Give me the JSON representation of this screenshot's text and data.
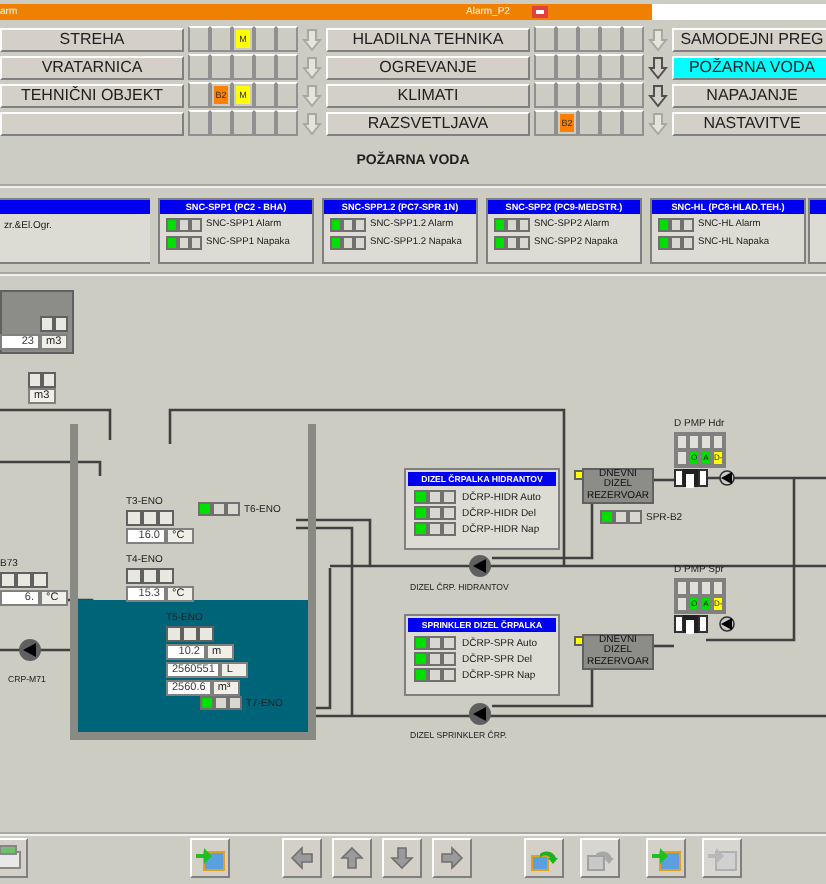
{
  "alarm_bar": {
    "left_text": "arm",
    "center_text": "Alarm_P2"
  },
  "nav_columns": [
    {
      "items": [
        {
          "label": "STREHA",
          "selected": false,
          "arrow_disabled": true,
          "cells": [
            {
              "kind": "blank"
            },
            {
              "kind": "blank"
            },
            {
              "kind": "badge",
              "text": "M",
              "color": "#ffff00"
            },
            {
              "kind": "blank"
            },
            {
              "kind": "blank"
            }
          ]
        },
        {
          "label": "VRATARNICA",
          "selected": false,
          "arrow_disabled": true,
          "cells": [
            {
              "kind": "blank"
            },
            {
              "kind": "blank"
            },
            {
              "kind": "blank"
            },
            {
              "kind": "blank"
            },
            {
              "kind": "blank"
            }
          ]
        },
        {
          "label": "TEHNIČNI OBJEKT",
          "selected": false,
          "arrow_disabled": true,
          "cells": [
            {
              "kind": "blank"
            },
            {
              "kind": "badge",
              "text": "B2",
              "color": "#ff8000"
            },
            {
              "kind": "badge",
              "text": "M",
              "color": "#ffff00"
            },
            {
              "kind": "blank"
            },
            {
              "kind": "blank"
            }
          ]
        },
        {
          "selected": false,
          "arrow_disabled": true,
          "cells": [
            {
              "kind": "blank"
            },
            {
              "kind": "blank"
            },
            {
              "kind": "blank"
            },
            {
              "kind": "blank"
            },
            {
              "kind": "blank"
            }
          ]
        }
      ]
    },
    {
      "items": [
        {
          "label": "HLADILNA TEHNIKA",
          "selected": false,
          "arrow_disabled": true,
          "cells": [
            {
              "kind": "blank"
            },
            {
              "kind": "blank"
            },
            {
              "kind": "blank"
            },
            {
              "kind": "blank"
            },
            {
              "kind": "blank"
            }
          ]
        },
        {
          "label": "OGREVANJE",
          "selected": false,
          "arrow_disabled": false,
          "cells": [
            {
              "kind": "blank"
            },
            {
              "kind": "blank"
            },
            {
              "kind": "blank"
            },
            {
              "kind": "blank"
            },
            {
              "kind": "blank"
            }
          ]
        },
        {
          "label": "KLIMATI",
          "selected": false,
          "arrow_disabled": false,
          "cells": [
            {
              "kind": "blank"
            },
            {
              "kind": "blank"
            },
            {
              "kind": "blank"
            },
            {
              "kind": "blank"
            },
            {
              "kind": "blank"
            }
          ]
        },
        {
          "label": "RAZSVETLJAVA",
          "selected": false,
          "arrow_disabled": true,
          "cells": [
            {
              "kind": "blank"
            },
            {
              "kind": "badge",
              "text": "B2",
              "color": "#ff8000"
            },
            {
              "kind": "blank"
            },
            {
              "kind": "blank"
            },
            {
              "kind": "blank"
            }
          ]
        }
      ]
    },
    {
      "items": [
        {
          "label": "SAMODEJNI PREG",
          "selected": false
        },
        {
          "label": "POŽARNA VODA",
          "selected": true
        },
        {
          "label": "NAPAJANJE",
          "selected": false
        },
        {
          "label": "NASTAVITVE",
          "selected": false
        }
      ]
    }
  ],
  "page_title": "POŽARNA VODA",
  "panels": [
    {
      "kind": "cut",
      "rows": [
        {
          "kind": "text",
          "label": "zr.&El.Ogr."
        }
      ]
    },
    {
      "title": "SNC-SPP1 (PC2 - BHA)",
      "rows": [
        {
          "kind": "lamp",
          "label": "SNC-SPP1 Alarm",
          "lamps": [
            true,
            false,
            false
          ]
        },
        {
          "kind": "lamp",
          "label": "SNC-SPP1 Napaka",
          "lamps": [
            true,
            false,
            false
          ]
        }
      ]
    },
    {
      "title": "SNC-SPP1.2 (PC7-SPR 1N)",
      "rows": [
        {
          "kind": "lamp",
          "label": "SNC-SPP1.2 Alarm",
          "lamps": [
            true,
            false,
            false
          ]
        },
        {
          "kind": "lamp",
          "label": "SNC-SPP1.2 Napaka",
          "lamps": [
            true,
            false,
            false
          ]
        }
      ]
    },
    {
      "title": "SNC-SPP2 (PC9-MEDSTR.)",
      "rows": [
        {
          "kind": "lamp",
          "label": "SNC-SPP2 Alarm",
          "lamps": [
            true,
            false,
            false
          ]
        },
        {
          "kind": "lamp",
          "label": "SNC-SPP2 Napaka",
          "lamps": [
            true,
            false,
            false
          ]
        }
      ]
    },
    {
      "title": "SNC-HL (PC8-HLAD.TEH.)",
      "rows": [
        {
          "kind": "lamp",
          "label": "SNC-HL Alarm",
          "lamps": [
            true,
            false,
            false
          ]
        },
        {
          "kind": "lamp",
          "label": "SNC-HL Napaka",
          "lamps": [
            true,
            false,
            false
          ]
        }
      ]
    },
    {
      "kind": "cut"
    }
  ],
  "storage_boxes": [
    {
      "value": "23",
      "unit": "m3"
    },
    {
      "unit": "m3"
    }
  ],
  "tank": {
    "level": 0.43
  },
  "sensors": [
    {
      "label": "B73",
      "values": [
        {
          "value": "6.",
          "unit": "°C"
        }
      ]
    },
    {
      "label": "T3-ENO",
      "values": [
        {
          "value": "16.0",
          "unit": "°C"
        }
      ]
    },
    {
      "label": "T4-ENO",
      "values": [
        {
          "value": "15.3",
          "unit": "°C"
        }
      ]
    },
    {
      "label": "T5-ENO",
      "values": [
        {
          "value": "10.2",
          "unit": "m"
        },
        {
          "value": "2560551",
          "unit": "L"
        },
        {
          "value": "2560.6",
          "unit": "m³"
        }
      ]
    }
  ],
  "lamps": [
    {
      "label": "T6-ENO",
      "lamps": [
        true,
        false,
        false
      ]
    },
    {
      "label": "T7-ENO",
      "lamps": [
        true,
        false,
        false
      ]
    },
    {
      "label": "SPR-B2",
      "lamps": [
        true,
        false,
        false
      ]
    }
  ],
  "pumps": [
    {
      "label": "CRP-M71"
    },
    {
      "label": "DIZEL ČRP. HIDRANTOV"
    },
    {
      "label": "DIZEL SPRINKLER ČRP."
    }
  ],
  "reservoirs": [
    {
      "label": "DNEVNI DIZEL REZERVOAR"
    },
    {
      "label": "DNEVNI DIZEL REZERVOAR"
    }
  ],
  "pump_status": [
    {
      "label": "D PMP Hdr",
      "cells": [
        {
          "kind": "blank"
        },
        {
          "kind": "blank"
        },
        {
          "kind": "blank"
        },
        {
          "kind": "blank"
        },
        {
          "kind": "blank"
        },
        {
          "kind": "badge",
          "text": "O",
          "color": "#00e000"
        },
        {
          "kind": "badge",
          "text": "A",
          "color": "#00e000"
        },
        {
          "kind": "badge",
          "text": "D-",
          "color": "#ffff00"
        }
      ]
    },
    {
      "label": "D PMP Spr",
      "cells": [
        {
          "kind": "blank"
        },
        {
          "kind": "blank"
        },
        {
          "kind": "blank"
        },
        {
          "kind": "blank"
        },
        {
          "kind": "blank"
        },
        {
          "kind": "badge",
          "text": "O",
          "color": "#00e000"
        },
        {
          "kind": "badge",
          "text": "A",
          "color": "#00e000"
        },
        {
          "kind": "badge",
          "text": "D-",
          "color": "#ffff00"
        }
      ]
    }
  ],
  "diesel_panels": [
    {
      "title": "DIZEL ČRPALKA HIDRANTOV",
      "rows": [
        {
          "label": "DČRP-HIDR Auto",
          "lamps": [
            true,
            false,
            false
          ]
        },
        {
          "label": "DČRP-HIDR Del",
          "lamps": [
            true,
            false,
            false
          ]
        },
        {
          "label": "DČRP-HIDR Nap",
          "lamps": [
            true,
            false,
            false
          ]
        }
      ]
    },
    {
      "title": "SPRINKLER DIZEL ČRPALKA",
      "rows": [
        {
          "label": "DČRP-SPR Auto",
          "lamps": [
            true,
            false,
            false
          ]
        },
        {
          "label": "DČRP-SPR Del",
          "lamps": [
            true,
            false,
            false
          ]
        },
        {
          "label": "DČRP-SPR Nap",
          "lamps": [
            true,
            false,
            false
          ]
        }
      ]
    }
  ],
  "toolbar": [
    {
      "kind": "print",
      "disabled": false
    },
    {
      "kind": "screen-in",
      "disabled": false
    },
    {
      "kind": "left",
      "disabled": false
    },
    {
      "kind": "up",
      "disabled": false
    },
    {
      "kind": "down",
      "disabled": false
    },
    {
      "kind": "right",
      "disabled": false
    },
    {
      "kind": "undo",
      "disabled": false
    },
    {
      "kind": "redo",
      "disabled": true
    },
    {
      "kind": "export",
      "disabled": false
    },
    {
      "kind": "next",
      "disabled": true
    }
  ]
}
